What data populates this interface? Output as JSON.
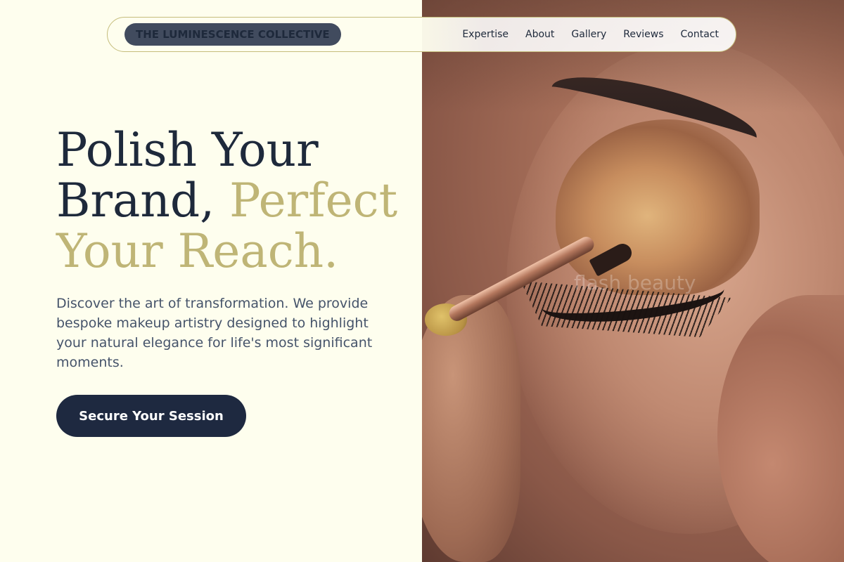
{
  "header": {
    "brand": "THE LUMINESCENCE COLLECTIVE",
    "nav": [
      "Expertise",
      "About",
      "Gallery",
      "Reviews",
      "Contact"
    ]
  },
  "hero": {
    "title_line1": "Polish Your",
    "title_line2_plain": "Brand,",
    "title_line2_accent": "Perfect",
    "title_line3_accent": "Your Reach.",
    "description": "Discover the art of transformation. We provide bespoke makeup artistry designed to highlight your natural elegance for life's most significant moments.",
    "cta_label": "Secure Your Session"
  },
  "image": {
    "watermark": "flash beauty"
  },
  "colors": {
    "background": "#fefeee",
    "primary": "#1e293b",
    "accent": "#bfb576",
    "text": "#45536a"
  }
}
